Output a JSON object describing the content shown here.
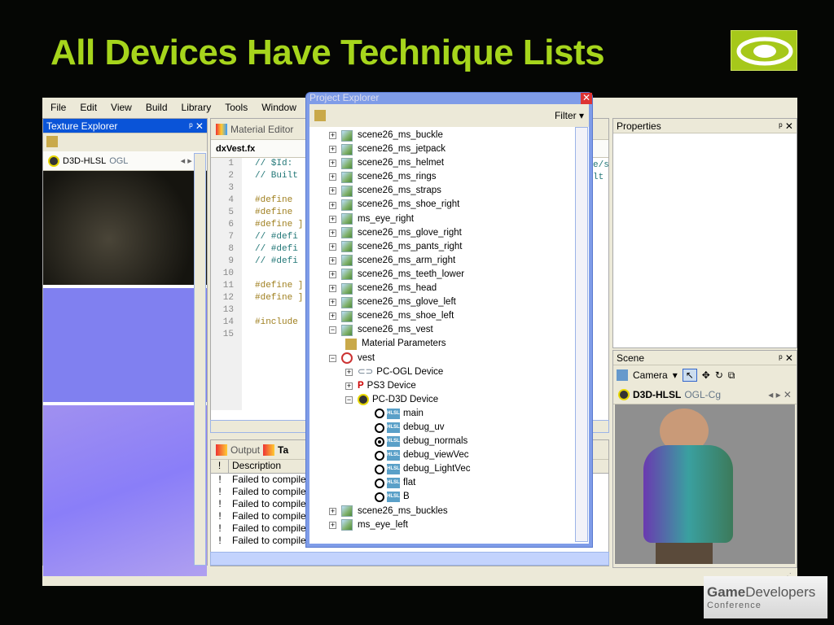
{
  "slide": {
    "title": "All Devices Have Technique Lists",
    "nvidia_logo": "NVIDIA",
    "footer_logo": "GameDevelopers Conference"
  },
  "menu": [
    "File",
    "Edit",
    "View",
    "Build",
    "Library",
    "Tools",
    "Window"
  ],
  "texture_explorer": {
    "title": "Texture Explorer",
    "tabs": [
      "D3D-HLSL",
      "OGL"
    ]
  },
  "editor": {
    "tab": "Material Editor",
    "file_tab": "dxVest.fx",
    "lines": [
      "1",
      "2",
      "3",
      "4",
      "5",
      "6",
      "7",
      "8",
      "9",
      "10",
      "11",
      "12",
      "13",
      "14",
      "15"
    ],
    "code": [
      "// $Id:",
      "// Built",
      "",
      "#define",
      "#define",
      "#define ]",
      "// #defi",
      "// #defi",
      "// #defi",
      "",
      "#define ]",
      "#define ]",
      "",
      "#include",
      ""
    ],
    "right_code": [
      "e/s",
      "lt"
    ]
  },
  "output": {
    "tabs": [
      "Output",
      "Ta"
    ],
    "columns": [
      "!",
      "Description"
    ],
    "rows": [
      {
        "flag": "!",
        "text": "Failed to compile I"
      },
      {
        "flag": "!",
        "text": "Failed to compile I"
      },
      {
        "flag": "!",
        "text": "Failed to compile I"
      },
      {
        "flag": "!",
        "text": "Failed to compile I"
      },
      {
        "flag": "!",
        "text": "Failed to compile I"
      },
      {
        "flag": "!",
        "text": "Failed to compile I"
      }
    ]
  },
  "project_explorer": {
    "title": "Project Explorer",
    "filter": "Filter",
    "items": [
      "scene26_ms_buckle",
      "scene26_ms_jetpack",
      "scene26_ms_helmet",
      "scene26_ms_rings",
      "scene26_ms_straps",
      "scene26_ms_shoe_right",
      "ms_eye_right",
      "scene26_ms_glove_right",
      "scene26_ms_pants_right",
      "scene26_ms_arm_right",
      "scene26_ms_teeth_lower",
      "scene26_ms_head",
      "scene26_ms_glove_left",
      "scene26_ms_shoe_left"
    ],
    "expanded": "scene26_ms_vest",
    "material_params": "Material Parameters",
    "material": "vest",
    "devices": [
      "PC-OGL Device",
      "PS3 Device",
      "PC-D3D Device"
    ],
    "techniques": [
      {
        "name": "main",
        "selected": false
      },
      {
        "name": "debug_uv",
        "selected": false
      },
      {
        "name": "debug_normals",
        "selected": true
      },
      {
        "name": "debug_viewVec",
        "selected": false
      },
      {
        "name": "debug_LightVec",
        "selected": false
      },
      {
        "name": "flat",
        "selected": false
      },
      {
        "name": "B",
        "selected": false
      }
    ],
    "technique_badge": "HLSL",
    "after": [
      "scene26_ms_buckles",
      "ms_eye_left"
    ]
  },
  "properties": {
    "title": "Properties"
  },
  "scene": {
    "title": "Scene",
    "camera": "Camera",
    "tabs": [
      "D3D-HLSL",
      "OGL-Cg"
    ]
  },
  "colors": {
    "title": "#a6d51c",
    "active_title": "#0a54d8",
    "chrome": "#ece9d8"
  }
}
